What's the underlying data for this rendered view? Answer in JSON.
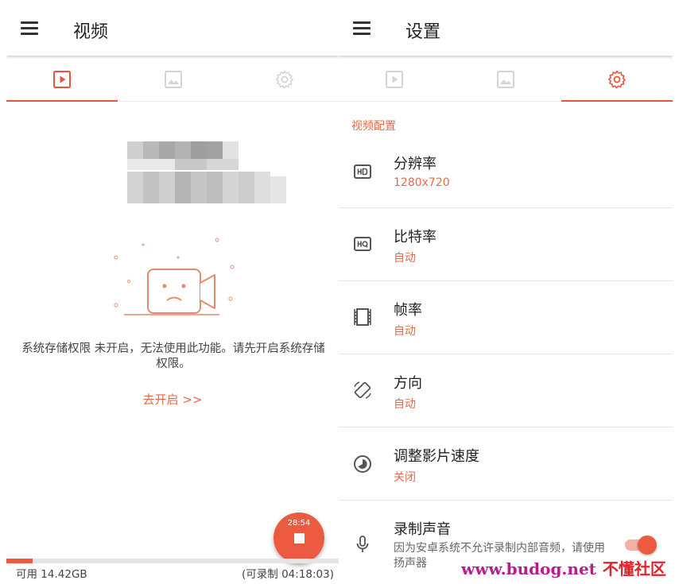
{
  "left": {
    "title": "视频",
    "message": "系统存储权限 未开启，无法使用此功能。请先开启系统存储权限。",
    "enable_link": "去开启 >>",
    "fab_time": "28:54",
    "storage_available": "可用 14.42GB",
    "storage_recordable": "(可录制 04:18:03)",
    "storage_used_fraction": 0.08,
    "tabs": [
      {
        "icon": "video-icon",
        "active": true
      },
      {
        "icon": "image-icon",
        "active": false
      },
      {
        "icon": "settings-icon",
        "active": false
      }
    ]
  },
  "right": {
    "title": "设置",
    "tabs": [
      {
        "icon": "video-icon",
        "active": false
      },
      {
        "icon": "image-icon",
        "active": false
      },
      {
        "icon": "settings-icon",
        "active": true
      }
    ],
    "section_header": "视频配置",
    "settings": [
      {
        "icon": "hd-icon",
        "title": "分辨率",
        "value": "1280x720"
      },
      {
        "icon": "hq-icon",
        "title": "比特率",
        "value": "自动"
      },
      {
        "icon": "film-icon",
        "title": "帧率",
        "value": "自动"
      },
      {
        "icon": "screen-rotation-icon",
        "title": "方向",
        "value": "自动"
      },
      {
        "icon": "speed-icon",
        "title": "调整影片速度",
        "value": "关闭"
      },
      {
        "icon": "microphone-icon",
        "title": "录制声音",
        "description": "因为安卓系统不允许录制内部音频，请使用扬声器",
        "toggle_on": true
      }
    ]
  },
  "watermark": {
    "url": "www.budog.net",
    "site": "不懂社区"
  },
  "colors": {
    "accent": "#ec5b41",
    "accent_text": "#e36b4a",
    "inactive_icon": "#cfcfcf"
  }
}
